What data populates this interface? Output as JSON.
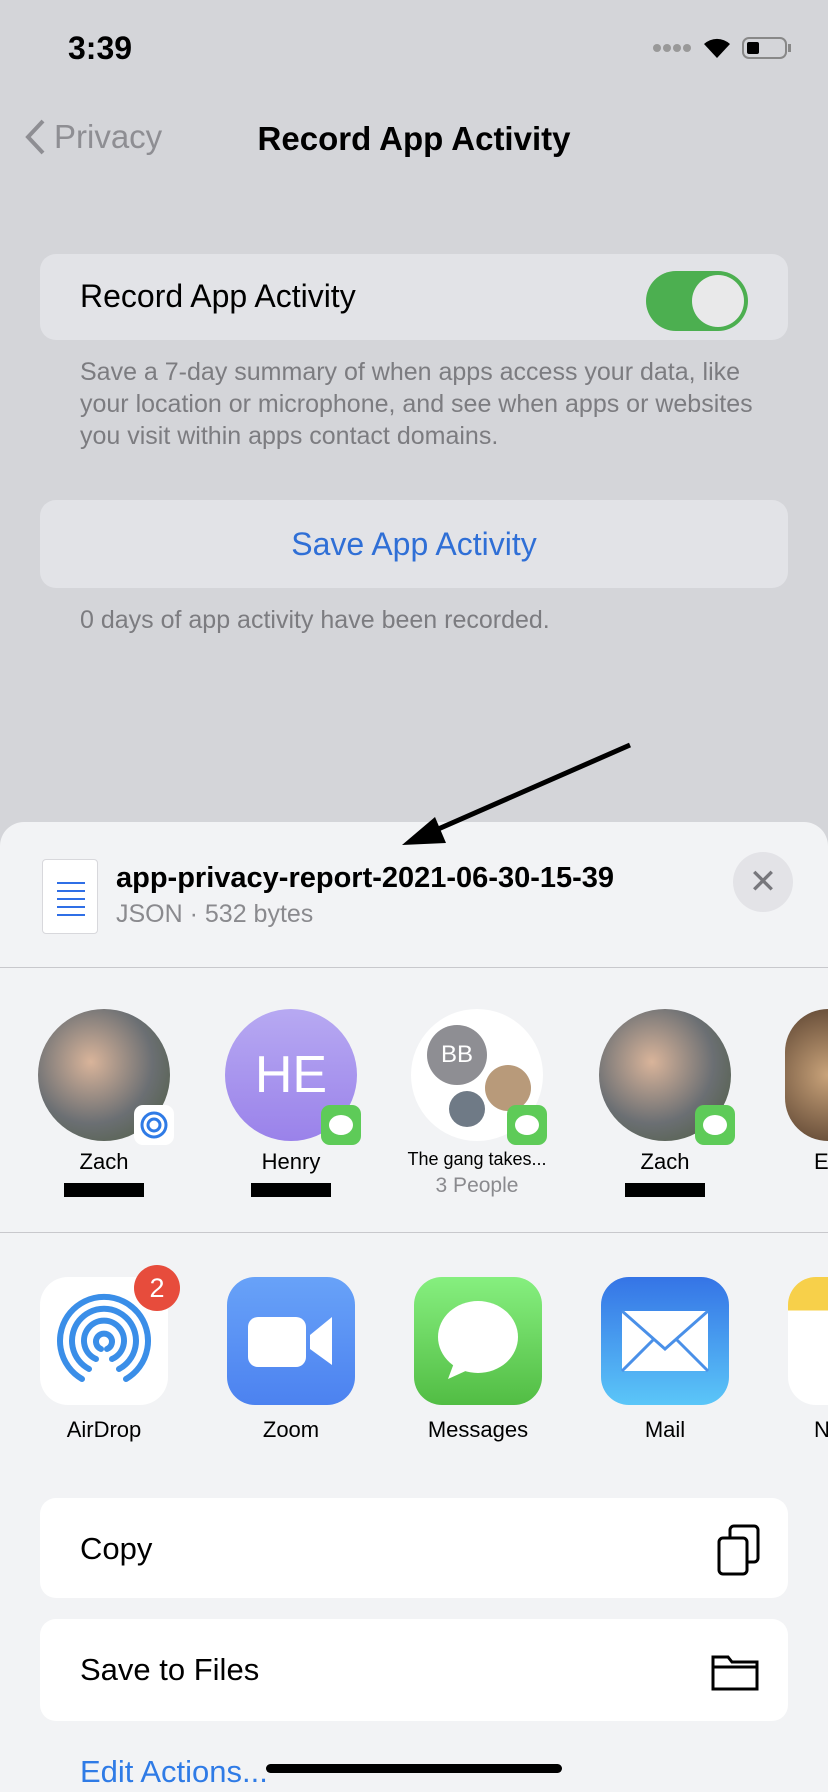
{
  "status_bar": {
    "time": "3:39"
  },
  "nav": {
    "back_label": "Privacy",
    "title": "Record App Activity"
  },
  "settings": {
    "record_toggle": {
      "label": "Record App Activity",
      "on": true,
      "color": "#4caf50"
    },
    "record_footer": "Save a 7-day summary of when apps access your data, like your location or microphone, and see when apps or websites you visit within apps contact domains.",
    "save_button": "Save App Activity",
    "save_footer": "0 days of app activity have been recorded."
  },
  "share_sheet": {
    "file": {
      "name": "app-privacy-report-2021-06-30-15-39",
      "meta": "JSON · 532 bytes"
    },
    "people": [
      {
        "name": "Zach",
        "sub": "",
        "badge": "airdrop-icon"
      },
      {
        "name": "Henry",
        "initials": "HE",
        "sub": "",
        "badge": "messages-icon"
      },
      {
        "name": "The gang takes...",
        "initials": "BB",
        "sub": "3 People",
        "badge": "messages-icon"
      },
      {
        "name": "Zach",
        "sub": "",
        "badge": "messages-icon"
      },
      {
        "name": "E",
        "sub": ""
      }
    ],
    "apps": [
      {
        "label": "AirDrop",
        "badge": "2"
      },
      {
        "label": "Zoom"
      },
      {
        "label": "Messages"
      },
      {
        "label": "Mail"
      },
      {
        "label": "N"
      }
    ],
    "actions": [
      {
        "label": "Copy",
        "icon": "copy-icon"
      },
      {
        "label": "Save to Files",
        "icon": "folder-icon"
      }
    ],
    "edit_actions": "Edit Actions..."
  }
}
